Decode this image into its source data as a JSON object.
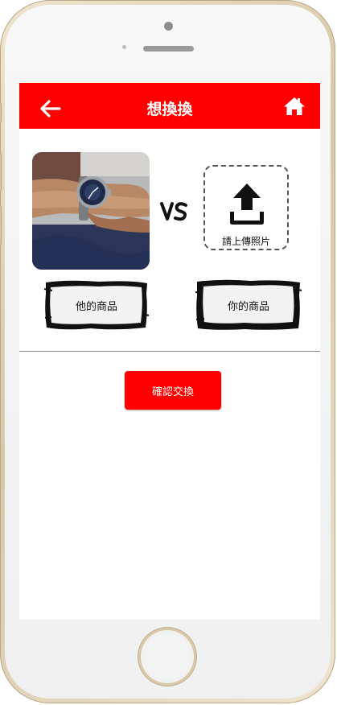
{
  "header": {
    "title": "想換換",
    "back_icon": "arrow-left-icon",
    "home_icon": "home-icon",
    "bg_color": "#ff0000"
  },
  "compare": {
    "their_item_label": "他的商品",
    "vs_label": "VS",
    "upload_label": "請上傳照片",
    "upload_icon": "upload-icon",
    "your_item_label": "你的商品"
  },
  "actions": {
    "confirm_label": "確認交換",
    "accent_color": "#ff0000"
  }
}
